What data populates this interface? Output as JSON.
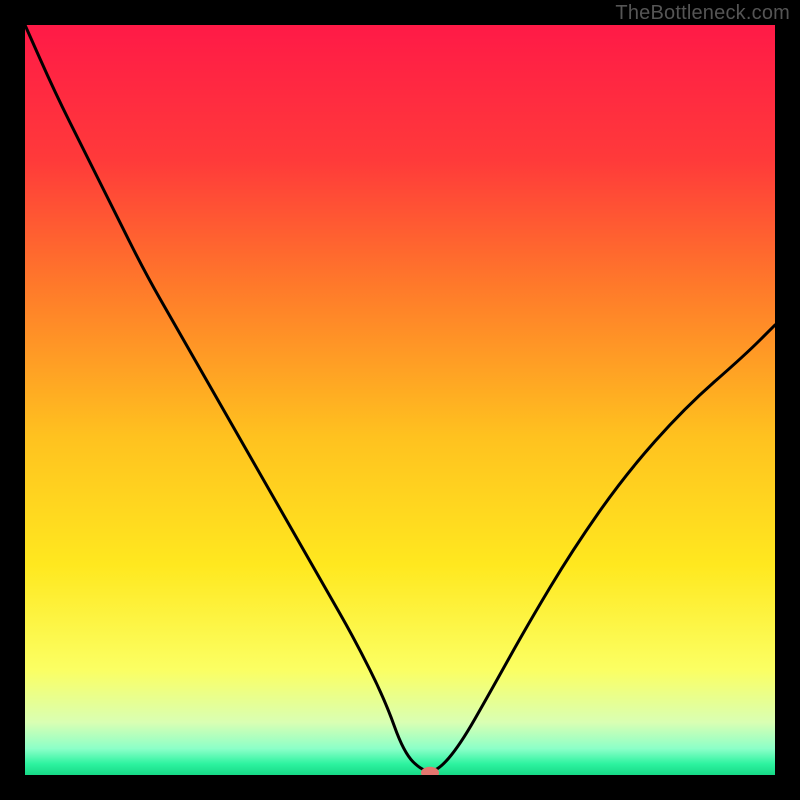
{
  "watermark": "TheBottleneck.com",
  "chart_data": {
    "type": "line",
    "title": "",
    "xlabel": "",
    "ylabel": "",
    "xlim": [
      0,
      100
    ],
    "ylim": [
      0,
      100
    ],
    "grid": false,
    "legend": false,
    "background_gradient_stops": [
      {
        "pos": 0.0,
        "color": "#ff1a47"
      },
      {
        "pos": 0.18,
        "color": "#ff3a3a"
      },
      {
        "pos": 0.35,
        "color": "#ff7a2a"
      },
      {
        "pos": 0.55,
        "color": "#ffc21f"
      },
      {
        "pos": 0.72,
        "color": "#ffe81f"
      },
      {
        "pos": 0.86,
        "color": "#fbff63"
      },
      {
        "pos": 0.93,
        "color": "#d9ffb3"
      },
      {
        "pos": 0.965,
        "color": "#8bffc8"
      },
      {
        "pos": 0.985,
        "color": "#2ef3a0"
      },
      {
        "pos": 1.0,
        "color": "#16d986"
      }
    ],
    "curve": {
      "x": [
        0,
        4,
        8,
        12,
        16,
        20,
        24,
        28,
        32,
        36,
        40,
        44,
        48,
        50.5,
        53,
        55,
        58,
        62,
        67,
        73,
        80,
        88,
        96,
        100
      ],
      "y": [
        100,
        91,
        83,
        75,
        67,
        60,
        53,
        46,
        39,
        32,
        25,
        18,
        10,
        3,
        0.5,
        0.5,
        4,
        11,
        20,
        30,
        40,
        49,
        56,
        60
      ]
    },
    "marker": {
      "x": 54,
      "y": 0.3,
      "color": "#e3766f"
    }
  }
}
